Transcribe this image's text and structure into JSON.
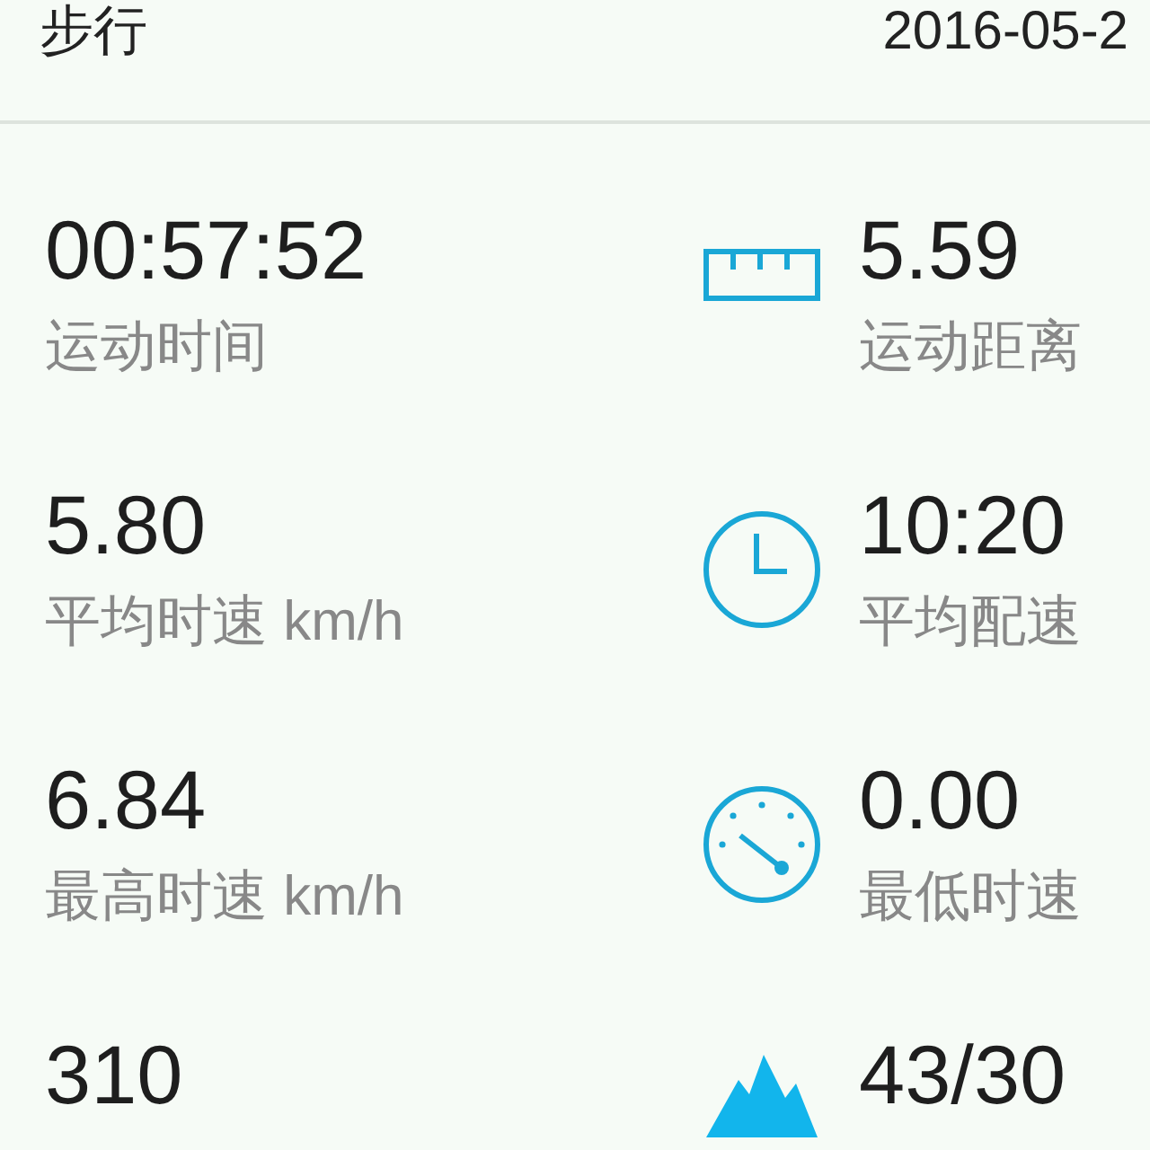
{
  "header": {
    "title": "步行",
    "date": "2016-05-2"
  },
  "rows": [
    {
      "left": {
        "value": "00:57:52",
        "label": "运动时间"
      },
      "right": {
        "kind": "ruler",
        "value": "5.59",
        "label": "运动距离"
      }
    },
    {
      "left": {
        "value": "5.80",
        "label": "平均时速 km/h"
      },
      "right": {
        "kind": "clock",
        "value": "10:20",
        "label": "平均配速"
      }
    },
    {
      "left": {
        "value": "6.84",
        "label": "最高时速 km/h"
      },
      "right": {
        "kind": "gauge",
        "value": "0.00",
        "label": "最低时速"
      }
    },
    {
      "left": {
        "value": "310"
      },
      "right": {
        "kind": "mountain",
        "value": "43/30"
      }
    }
  ]
}
